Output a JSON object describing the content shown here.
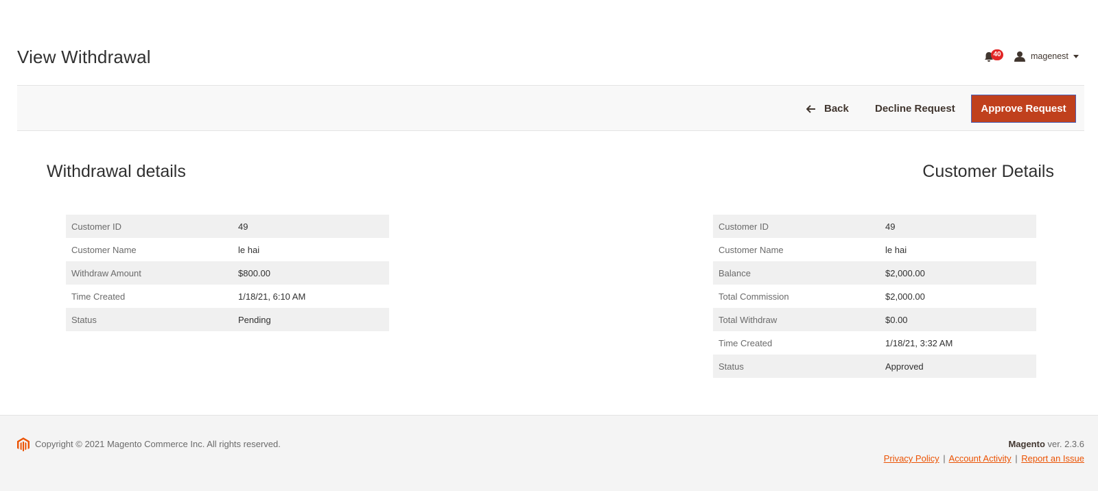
{
  "header": {
    "title": "View Withdrawal",
    "notifications_count": "40",
    "user_name": "magenest",
    "icons": {
      "notifications": "bell-icon",
      "user": "user-icon",
      "dropdown": "caret-down-icon"
    }
  },
  "actions": {
    "back_label": "Back",
    "decline_label": "Decline Request",
    "approve_label": "Approve Request"
  },
  "withdrawal_details": {
    "title": "Withdrawal details",
    "rows": [
      {
        "label": "Customer ID",
        "value": "49"
      },
      {
        "label": "Customer Name",
        "value": "le hai"
      },
      {
        "label": "Withdraw Amount",
        "value": "$800.00"
      },
      {
        "label": "Time Created",
        "value": "1/18/21, 6:10 AM"
      },
      {
        "label": "Status",
        "value": "Pending"
      }
    ]
  },
  "customer_details": {
    "title": "Customer Details",
    "rows": [
      {
        "label": "Customer ID",
        "value": "49"
      },
      {
        "label": "Customer Name",
        "value": "le hai"
      },
      {
        "label": "Balance",
        "value": "$2,000.00"
      },
      {
        "label": "Total Commission",
        "value": "$2,000.00"
      },
      {
        "label": "Total Withdraw",
        "value": "$0.00"
      },
      {
        "label": "Time Created",
        "value": "1/18/21, 3:32 AM"
      },
      {
        "label": "Status",
        "value": "Approved"
      }
    ]
  },
  "footer": {
    "copyright": "Copyright © 2021 Magento Commerce Inc. All rights reserved.",
    "brand": "Magento",
    "version": " ver. 2.3.6",
    "links": {
      "privacy": "Privacy Policy",
      "account_activity": " Account Activity",
      "report_issue": "Report an Issue"
    },
    "separator": "|"
  },
  "colors": {
    "primary_button": "#c0401d",
    "link": "#eb5202",
    "badge": "#e22626",
    "stripe": "#f0f0f0"
  }
}
